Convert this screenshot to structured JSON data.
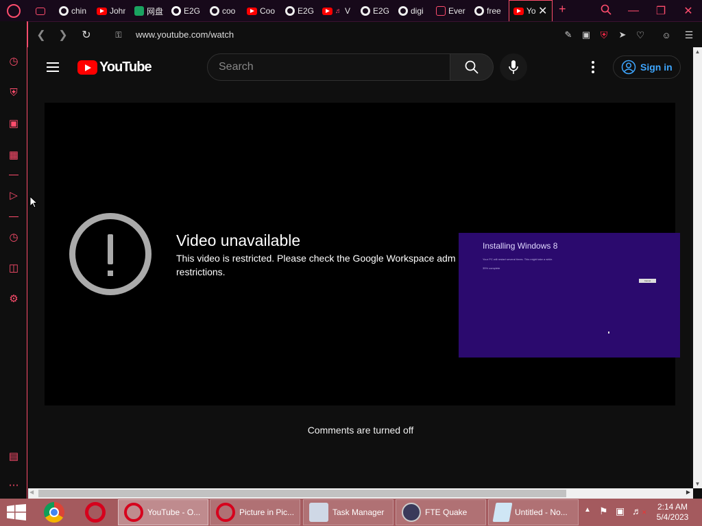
{
  "browser": {
    "tabs": [
      {
        "label": "chin",
        "icon": "web"
      },
      {
        "label": "John",
        "icon": "youtube"
      },
      {
        "label": "网盘",
        "icon": "share"
      },
      {
        "label": "E2G",
        "icon": "github"
      },
      {
        "label": "coo",
        "icon": "web"
      },
      {
        "label": "Coo",
        "icon": "youtube"
      },
      {
        "label": "E2G",
        "icon": "web"
      },
      {
        "label": "V",
        "icon": "youtube-audio"
      },
      {
        "label": "E2G",
        "icon": "web"
      },
      {
        "label": "digi",
        "icon": "web"
      },
      {
        "label": "Ever",
        "icon": "tv"
      },
      {
        "label": "free",
        "icon": "web"
      }
    ],
    "active_tab": {
      "label": "Yo",
      "icon": "youtube"
    },
    "url": "www.youtube.com/watch",
    "accent_color": "#ff4d6d"
  },
  "youtube": {
    "logo_text": "YouTube",
    "search_placeholder": "Search",
    "sign_in_label": "Sign in",
    "video_title": "Video unavailable",
    "video_message": "This video is restricted. Please check the Google Workspace adm",
    "video_message_2": "restrictions.",
    "comments_text": "Comments are turned off"
  },
  "pip": {
    "title": "Installing Windows 8",
    "subtitle": "Your PC will restart several times. This might take a while.",
    "progress": "35% complete",
    "cancel_label": "Cancel"
  },
  "taskbar": {
    "items": [
      {
        "label": "YouTube - O...",
        "icon": "opera-icon"
      },
      {
        "label": "Picture in Pic...",
        "icon": "opera-icon"
      },
      {
        "label": "Task Manager",
        "icon": "task-manager-icon"
      },
      {
        "label": "FTE Quake",
        "icon": "quake-icon"
      },
      {
        "label": "Untitled - No...",
        "icon": "notepad-icon"
      }
    ],
    "time": "2:14 AM",
    "date": "5/4/2023",
    "color": "#a45a5e"
  }
}
